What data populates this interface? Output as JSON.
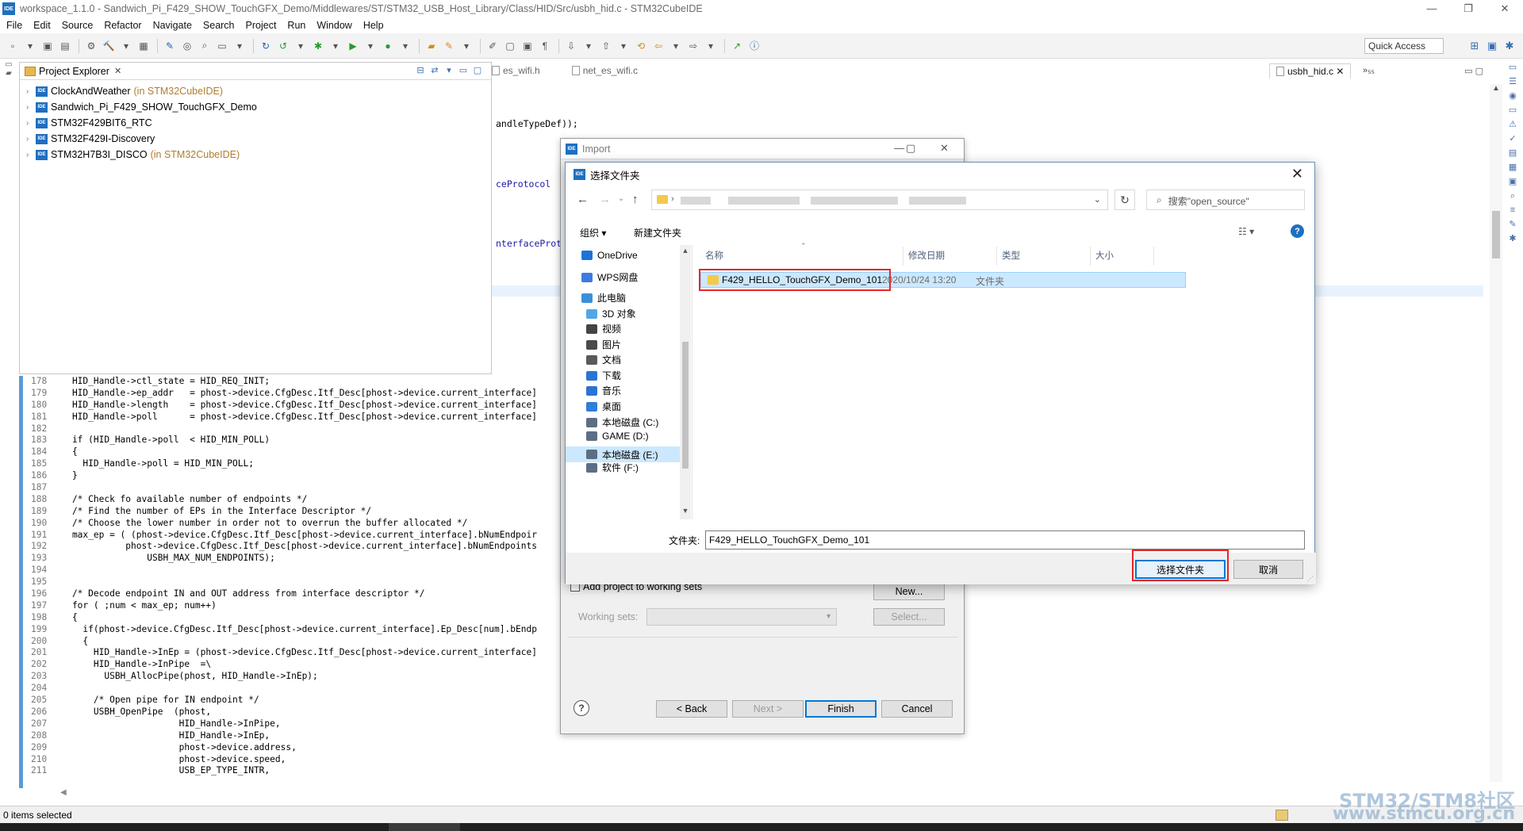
{
  "window": {
    "app_icon": "IDE",
    "title": "workspace_1.1.0 - Sandwich_Pi_F429_SHOW_TouchGFX_Demo/Middlewares/ST/STM32_USB_Host_Library/Class/HID/Src/usbh_hid.c - STM32CubeIDE",
    "min": "—",
    "max": "❐",
    "close": "✕"
  },
  "menu": [
    "File",
    "Edit",
    "Source",
    "Refactor",
    "Navigate",
    "Search",
    "Project",
    "Run",
    "Window",
    "Help"
  ],
  "toolbar": {
    "quick_access": "Quick Access"
  },
  "project_explorer": {
    "title": "Project Explorer",
    "close": "✕",
    "projects": [
      {
        "name": "ClockAndWeather",
        "suffix": "(in STM32CubeIDE)"
      },
      {
        "name": "Sandwich_Pi_F429_SHOW_TouchGFX_Demo",
        "suffix": ""
      },
      {
        "name": "STM32F429BIT6_RTC",
        "suffix": ""
      },
      {
        "name": "STM32F429I-Discovery",
        "suffix": ""
      },
      {
        "name": "STM32H7B3I_DISCO",
        "suffix": "(in STM32CubeIDE)"
      }
    ]
  },
  "editor": {
    "tabs": [
      "es_wifi.h",
      "net_es_wifi.c"
    ],
    "active_tab": "usbh_hid.c",
    "more_tabs": "»₅₅",
    "hint_1": "andleTypeDef));",
    "hint_2": "ceProtocol",
    "hint_3": "nterfaceProt",
    "code_lines": [
      {
        "n": "178",
        "t": "    HID_Handle->ctl_state = HID_REQ_INIT;"
      },
      {
        "n": "179",
        "t": "    HID_Handle->ep_addr   = phost->device.CfgDesc.Itf_Desc[phost->device.current_interface]"
      },
      {
        "n": "180",
        "t": "    HID_Handle->length    = phost->device.CfgDesc.Itf_Desc[phost->device.current_interface]"
      },
      {
        "n": "181",
        "t": "    HID_Handle->poll      = phost->device.CfgDesc.Itf_Desc[phost->device.current_interface]"
      },
      {
        "n": "182",
        "t": ""
      },
      {
        "n": "183",
        "t": "    if (HID_Handle->poll  < HID_MIN_POLL)"
      },
      {
        "n": "184",
        "t": "    {"
      },
      {
        "n": "185",
        "t": "      HID_Handle->poll = HID_MIN_POLL;"
      },
      {
        "n": "186",
        "t": "    }"
      },
      {
        "n": "187",
        "t": ""
      },
      {
        "n": "188",
        "t": "    /* Check fo available number of endpoints */"
      },
      {
        "n": "189",
        "t": "    /* Find the number of EPs in the Interface Descriptor */"
      },
      {
        "n": "190",
        "t": "    /* Choose the lower number in order not to overrun the buffer allocated */"
      },
      {
        "n": "191",
        "t": "    max_ep = ( (phost->device.CfgDesc.Itf_Desc[phost->device.current_interface].bNumEndpoir"
      },
      {
        "n": "192",
        "t": "              phost->device.CfgDesc.Itf_Desc[phost->device.current_interface].bNumEndpoints"
      },
      {
        "n": "193",
        "t": "                  USBH_MAX_NUM_ENDPOINTS);"
      },
      {
        "n": "194",
        "t": ""
      },
      {
        "n": "195",
        "t": ""
      },
      {
        "n": "196",
        "t": "    /* Decode endpoint IN and OUT address from interface descriptor */"
      },
      {
        "n": "197",
        "t": "    for ( ;num < max_ep; num++)"
      },
      {
        "n": "198",
        "t": "    {"
      },
      {
        "n": "199",
        "t": "      if(phost->device.CfgDesc.Itf_Desc[phost->device.current_interface].Ep_Desc[num].bEndp"
      },
      {
        "n": "200",
        "t": "      {"
      },
      {
        "n": "201",
        "t": "        HID_Handle->InEp = (phost->device.CfgDesc.Itf_Desc[phost->device.current_interface]"
      },
      {
        "n": "202",
        "t": "        HID_Handle->InPipe  =\\"
      },
      {
        "n": "203",
        "t": "          USBH_AllocPipe(phost, HID_Handle->InEp);"
      },
      {
        "n": "204",
        "t": ""
      },
      {
        "n": "205",
        "t": "        /* Open pipe for IN endpoint */"
      },
      {
        "n": "206",
        "t": "        USBH_OpenPipe  (phost,"
      },
      {
        "n": "207",
        "t": "                        HID_Handle->InPipe,"
      },
      {
        "n": "208",
        "t": "                        HID_Handle->InEp,"
      },
      {
        "n": "209",
        "t": "                        phost->device.address,"
      },
      {
        "n": "210",
        "t": "                        phost->device.speed,"
      },
      {
        "n": "211",
        "t": "                        USB_EP_TYPE_INTR,"
      }
    ]
  },
  "import_dialog": {
    "title": "Import",
    "add_to_working_sets": "Add project to working sets",
    "new_button": "New...",
    "working_sets_label": "Working sets:",
    "select_button": "Select...",
    "back_button": "< Back",
    "next_button": "Next >",
    "finish_button": "Finish",
    "cancel_button": "Cancel",
    "help": "?"
  },
  "folder_dialog": {
    "title": "选择文件夹",
    "search_placeholder": "搜索\"open_source\"",
    "organize": "组织 ▾",
    "new_folder": "新建文件夹",
    "view": "☷ ▾",
    "help": "?",
    "nav_items": [
      {
        "label": "OneDrive",
        "icon": "cloud-icon",
        "color": "#1e73d8"
      },
      {
        "label": "WPS网盘",
        "icon": "cloud-icon",
        "color": "#3d7be0"
      },
      {
        "label": "此电脑",
        "icon": "computer-icon",
        "color": "#3b8fd9"
      },
      {
        "label": "3D 对象",
        "icon": "cube-icon",
        "color": "#53a6e6"
      },
      {
        "label": "视频",
        "icon": "video-icon",
        "color": "#444444"
      },
      {
        "label": "图片",
        "icon": "picture-icon",
        "color": "#4a4a4a"
      },
      {
        "label": "文档",
        "icon": "document-icon",
        "color": "#5a5a5a"
      },
      {
        "label": "下载",
        "icon": "download-icon",
        "color": "#2b73d4"
      },
      {
        "label": "音乐",
        "icon": "music-icon",
        "color": "#2b73d4"
      },
      {
        "label": "桌面",
        "icon": "desktop-icon",
        "color": "#2f7ed8"
      },
      {
        "label": "本地磁盘 (C:)",
        "icon": "drive-icon",
        "color": "#5b6e84"
      },
      {
        "label": "GAME (D:)",
        "icon": "drive-icon",
        "color": "#5b6e84"
      },
      {
        "label": "本地磁盘 (E:)",
        "icon": "drive-icon",
        "color": "#5b6e84"
      },
      {
        "label": "软件 (F:)",
        "icon": "drive-icon",
        "color": "#5b6e84"
      }
    ],
    "columns": [
      "名称",
      "修改日期",
      "类型",
      "大小"
    ],
    "rows": [
      {
        "name": "F429_HELLO_TouchGFX_Demo_101",
        "date": "2020/10/24 13:20",
        "type": "文件夹",
        "size": ""
      }
    ],
    "folder_label": "文件夹:",
    "folder_value": "F429_HELLO_TouchGFX_Demo_101",
    "select_button": "选择文件夹",
    "cancel_button": "取消"
  },
  "status": {
    "selection": "0 items selected"
  },
  "watermark": {
    "line1": "STM32/STM8社区",
    "line2": "www.stmcu.org.cn"
  },
  "colors": {
    "highlight_red": "#e12828",
    "selection_blue": "#cce8ff",
    "accent": "#0078d7"
  }
}
